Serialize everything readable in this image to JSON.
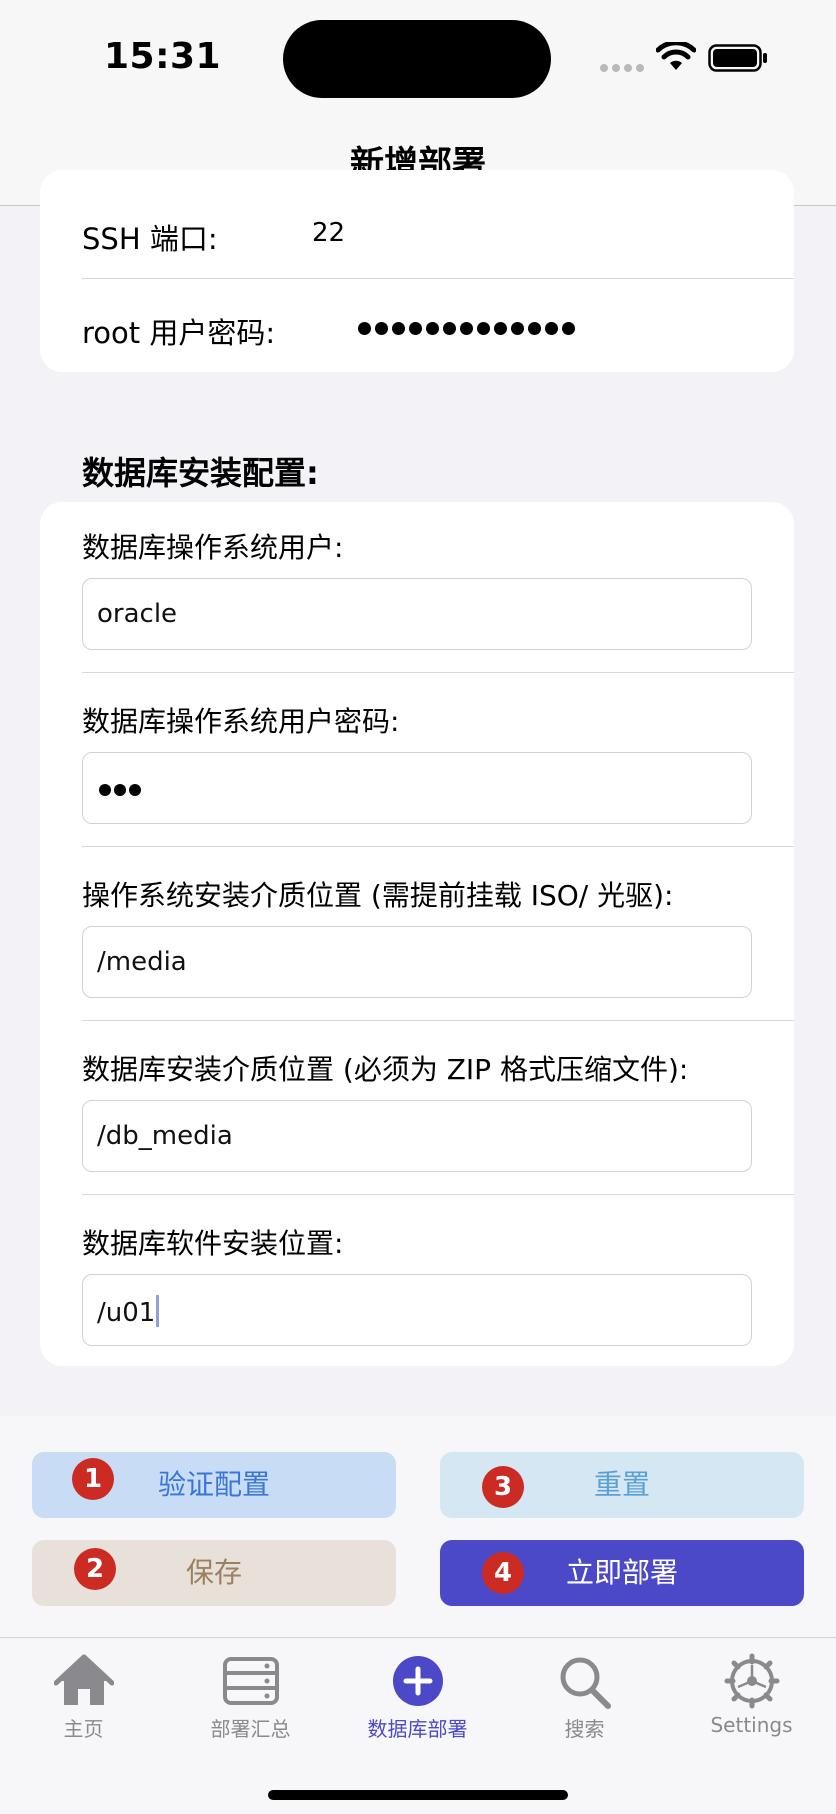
{
  "status_bar": {
    "time": "15:31"
  },
  "nav": {
    "title": "新增部署"
  },
  "connection": {
    "ssh_port_label": "SSH 端口:",
    "ssh_port_value": "22",
    "root_password_label": "root 用户密码:",
    "root_password_mask_count": 13
  },
  "db_section": {
    "title": "数据库安装配置:",
    "fields": [
      {
        "label": "数据库操作系统用户:",
        "value": "oracle",
        "masked": false
      },
      {
        "label": "数据库操作系统用户密码:",
        "value": "",
        "masked": true,
        "mask_count": 3
      },
      {
        "label": "操作系统安装介质位置 (需提前挂载 ISO/ 光驱):",
        "value": "/media",
        "masked": false
      },
      {
        "label": "数据库安装介质位置 (必须为 ZIP 格式压缩文件):",
        "value": "/db_media",
        "masked": false
      },
      {
        "label": "数据库软件安装位置:",
        "value": "/u01",
        "masked": false,
        "focused": true
      }
    ]
  },
  "actions": {
    "verify": {
      "label": "验证配置",
      "badge": "1"
    },
    "save": {
      "label": "保存",
      "badge": "2"
    },
    "reset": {
      "label": "重置",
      "badge": "3"
    },
    "deploy": {
      "label": "立即部署",
      "badge": "4"
    }
  },
  "tabs": [
    {
      "label": "主页",
      "icon": "house-icon",
      "active": false
    },
    {
      "label": "部署汇总",
      "icon": "server-icon",
      "active": false
    },
    {
      "label": "数据库部署",
      "icon": "plus-circle-icon",
      "active": true
    },
    {
      "label": "搜索",
      "icon": "magnifier-icon",
      "active": false
    },
    {
      "label": "Settings",
      "icon": "gear-icon",
      "active": false
    }
  ],
  "colors": {
    "accent": "#4b49c8",
    "badge": "#cc2b24",
    "verify_bg": "#c8dcf5",
    "reset_bg": "#d4e7f3",
    "save_bg": "#e7e1d9"
  }
}
